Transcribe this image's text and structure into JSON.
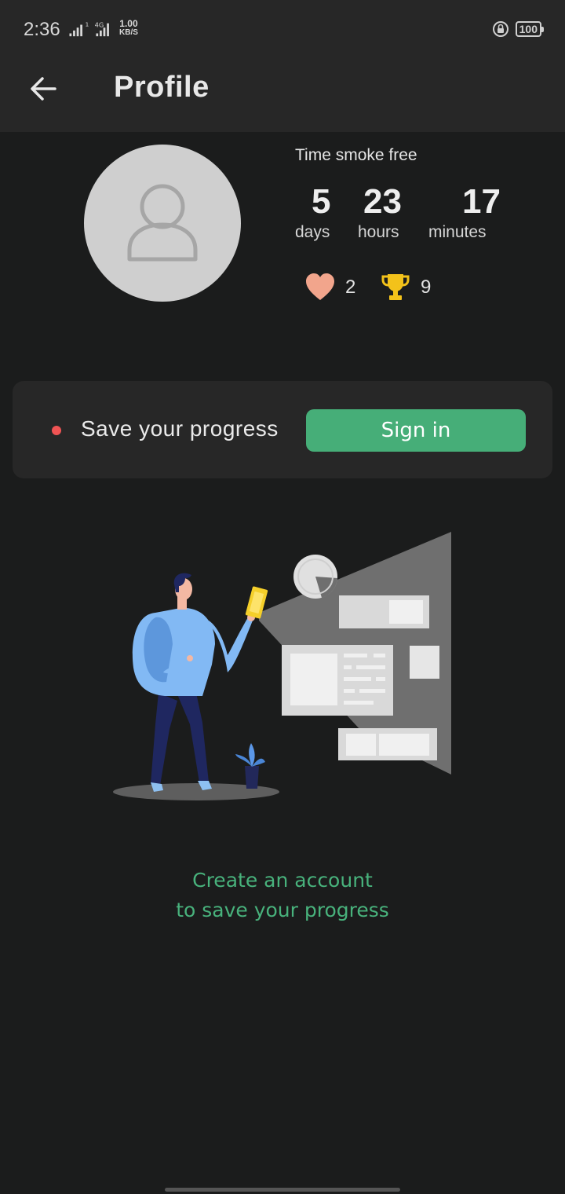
{
  "status": {
    "time": "2:36",
    "net_speed_value": "1.00",
    "net_speed_unit": "KB/S",
    "battery": "100",
    "network_label": "4G"
  },
  "appbar": {
    "title": "Profile",
    "back_icon": "arrow-left-icon"
  },
  "profile": {
    "avatar_icon": "user-icon",
    "time_label": "Time smoke free",
    "stats": [
      {
        "value": "5",
        "unit": "days"
      },
      {
        "value": "23",
        "unit": "hours"
      },
      {
        "value": "17",
        "unit": "minutes"
      }
    ],
    "badges": [
      {
        "icon": "heart-icon",
        "value": "2",
        "color": "#f2a58c"
      },
      {
        "icon": "trophy-icon",
        "value": "9",
        "color": "#f3c21a"
      }
    ]
  },
  "card": {
    "text": "Save your progress",
    "button": "Sign in",
    "accent": "#46ae78",
    "dot_color": "#f05454"
  },
  "cta": {
    "line1": "Create an account",
    "line2": "to save your progress"
  }
}
